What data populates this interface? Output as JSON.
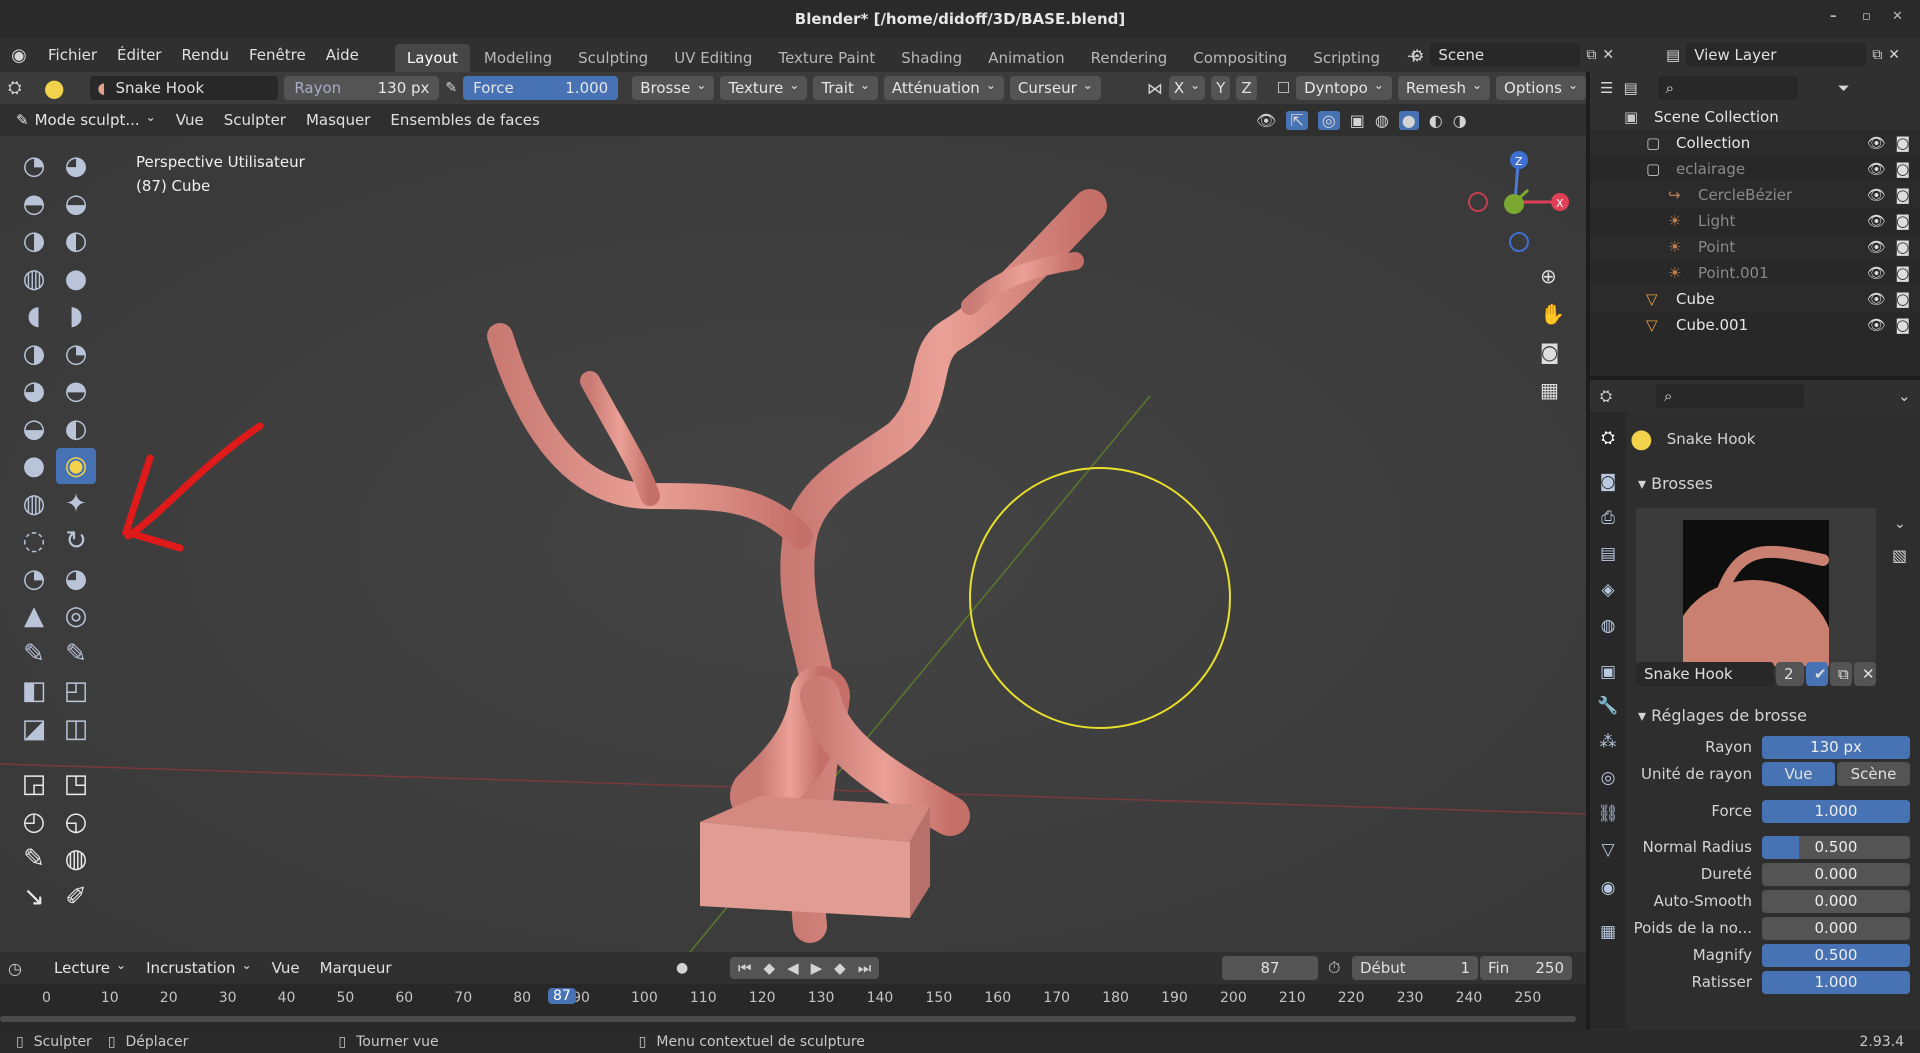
{
  "window": {
    "title": "Blender* [/home/didoff/3D/BASE.blend]"
  },
  "menu": [
    "Fichier",
    "Éditer",
    "Rendu",
    "Fenêtre",
    "Aide"
  ],
  "workspaces": [
    "Layout",
    "Modeling",
    "Sculpting",
    "UV Editing",
    "Texture Paint",
    "Shading",
    "Animation",
    "Rendering",
    "Compositing",
    "Scripting"
  ],
  "scene": {
    "label": "Scene",
    "view_layer": "View Layer"
  },
  "tool_header": {
    "brush_name": "Snake Hook",
    "radius_label": "Rayon",
    "radius_value": "130 px",
    "strength_label": "Force",
    "strength_value": "1.000",
    "strength_fill": 1.0,
    "menus": [
      "Brosse",
      "Texture",
      "Trait",
      "Atténuation",
      "Curseur"
    ],
    "axes": [
      "X",
      "Y",
      "Z"
    ],
    "dyntopo": "Dyntopo",
    "remesh": "Remesh",
    "options": "Options"
  },
  "mode_header": {
    "mode": "Mode sculpt...",
    "menus": [
      "Vue",
      "Sculpter",
      "Masquer",
      "Ensembles de faces"
    ]
  },
  "viewport": {
    "perspective": "Perspective Utilisateur",
    "object": "(87) Cube",
    "gizmo_axes": [
      "Z",
      "Y",
      "X"
    ]
  },
  "tools": {
    "icons": [
      "draw",
      "draw-sharp",
      "clay",
      "clay-strips",
      "clay-thumb",
      "layer",
      "inflate",
      "blob",
      "crease",
      "smooth",
      "flatten",
      "fill",
      "scrape",
      "multiplane-scrape",
      "pinch",
      "grab",
      "elastic-deform",
      "snake-hook",
      "thumb",
      "pose",
      "nudge",
      "rotate",
      "slide-relax",
      "boundary",
      "cloth",
      "simplify",
      "mask",
      "draw-face-sets",
      "box-mask",
      "lasso-mask",
      "box-face-set",
      "line-project",
      "box-trim",
      "mesh-filter",
      "cloth-filter",
      "color-filter",
      "edit-face-set",
      "mask-by-color",
      "transform",
      "annotate"
    ],
    "active": "snake-hook"
  },
  "timeline": {
    "menus": [
      "Lecture",
      "Incrustation",
      "Vue",
      "Marqueur"
    ],
    "current_frame": "87",
    "start_label": "Début",
    "start": "1",
    "end_label": "Fin",
    "end": "250",
    "ticks": [
      "0",
      "10",
      "20",
      "30",
      "40",
      "50",
      "60",
      "70",
      "80",
      "90",
      "100",
      "110",
      "120",
      "130",
      "140",
      "150",
      "160",
      "170",
      "180",
      "190",
      "200",
      "210",
      "220",
      "230",
      "240",
      "250"
    ]
  },
  "status": {
    "left_click": "Sculpter",
    "right_drag": "Déplacer",
    "middle": "Tourner vue",
    "context": "Menu contextuel de sculpture",
    "version": "2.93.4"
  },
  "outliner": {
    "rows": [
      {
        "name": "Scene Collection",
        "indent": 0,
        "dim": false
      },
      {
        "name": "Collection",
        "indent": 1,
        "dim": false
      },
      {
        "name": "eclairage",
        "indent": 1,
        "dim": true
      },
      {
        "name": "CercleBézier",
        "indent": 2,
        "dim": true
      },
      {
        "name": "Light",
        "indent": 2,
        "dim": true
      },
      {
        "name": "Point",
        "indent": 2,
        "dim": true
      },
      {
        "name": "Point.001",
        "indent": 2,
        "dim": true
      },
      {
        "name": "Cube",
        "indent": 1,
        "dim": false
      },
      {
        "name": "Cube.001",
        "indent": 1,
        "dim": false
      }
    ]
  },
  "properties": {
    "brush_title": "Snake Hook",
    "section_brushes": "Brosses",
    "brush_field": "Snake Hook",
    "brush_users": "2",
    "section_settings": "Réglages de brosse",
    "rows": [
      {
        "label": "Rayon",
        "value": "130 px",
        "fill": 1.0
      },
      {
        "label": "Unité de rayon",
        "value": "",
        "fill": 0
      },
      {
        "label": "Force",
        "value": "1.000",
        "fill": 1.0
      },
      {
        "label": "Normal Radius",
        "value": "0.500",
        "fill": 0.25
      },
      {
        "label": "Dureté",
        "value": "0.000",
        "fill": 0
      },
      {
        "label": "Auto-Smooth",
        "value": "0.000",
        "fill": 0
      },
      {
        "label": "Poids de la no...",
        "value": "0.000",
        "fill": 0
      },
      {
        "label": "Magnify",
        "value": "0.500",
        "fill": 1.0
      },
      {
        "label": "Ratisser",
        "value": "1.000",
        "fill": 1.0
      }
    ],
    "unit_options": [
      "Vue",
      "Scène"
    ]
  },
  "colors": {
    "accent": "#4772b3",
    "brush_cursor": "#e8e02a",
    "annotation_arrow": "#e01a1a",
    "mesh": "#e89a90"
  }
}
